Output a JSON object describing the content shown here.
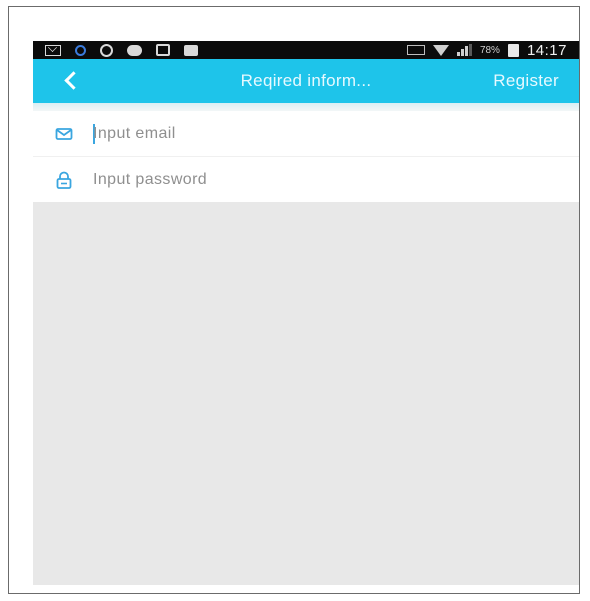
{
  "status_bar": {
    "battery_percent": "78%",
    "time": "14:17",
    "icons": [
      "mail-icon",
      "app-icon",
      "instagram-icon",
      "wechat-icon",
      "bag-icon",
      "camera-icon",
      "nfc-icon",
      "wifi-icon",
      "signal-icon",
      "battery-icon"
    ]
  },
  "nav": {
    "back_icon": "chevron-left-icon",
    "title": "Reqired inform...",
    "register_label": "Register"
  },
  "form": {
    "email": {
      "icon": "envelope-icon",
      "placeholder": "Input email",
      "value": ""
    },
    "password": {
      "icon": "lock-icon",
      "placeholder": "Input password",
      "value": ""
    }
  },
  "colors": {
    "accent": "#1ec4ea",
    "icon": "#3aa6e0",
    "background": "#e8e8e8"
  }
}
